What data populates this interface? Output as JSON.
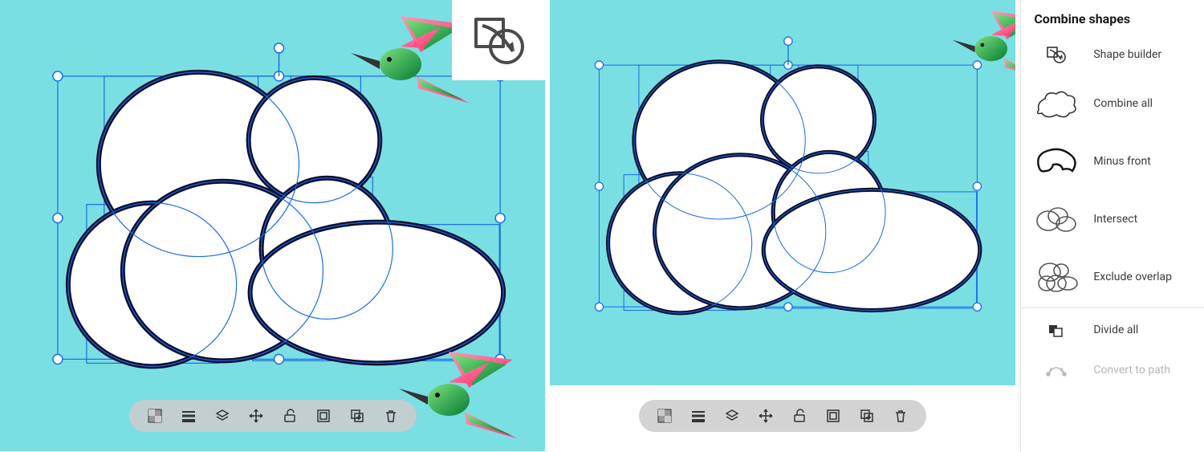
{
  "colors": {
    "canvas_bg": "#79dfe3",
    "selection": "#1a6de6",
    "shape_stroke": "#0b0d2c",
    "shape_fill": "#ffffff",
    "bird_pink": "#ff4b86",
    "bird_green": "#1eab4f"
  },
  "panel": {
    "title": "Combine shapes",
    "items": [
      {
        "id": "shape-builder",
        "label": "Shape builder",
        "disabled": false
      },
      {
        "id": "combine-all",
        "label": "Combine all",
        "disabled": false
      },
      {
        "id": "minus-front",
        "label": "Minus front",
        "disabled": false
      },
      {
        "id": "intersect",
        "label": "Intersect",
        "disabled": false
      },
      {
        "id": "exclude-overlap",
        "label": "Exclude overlap",
        "disabled": false
      },
      {
        "id": "divide-all",
        "label": "Divide all",
        "disabled": false
      },
      {
        "id": "convert-to-path",
        "label": "Convert to path",
        "disabled": true
      }
    ]
  },
  "toolbar": {
    "items": [
      {
        "id": "fill-swatch",
        "tooltip": "Fill"
      },
      {
        "id": "stroke-weight",
        "tooltip": "Stroke"
      },
      {
        "id": "layers",
        "tooltip": "Arrange"
      },
      {
        "id": "move",
        "tooltip": "Move"
      },
      {
        "id": "lock",
        "tooltip": "Lock"
      },
      {
        "id": "group",
        "tooltip": "Group"
      },
      {
        "id": "duplicate",
        "tooltip": "Duplicate"
      },
      {
        "id": "delete",
        "tooltip": "Delete"
      }
    ]
  },
  "callout": {
    "icon": "shape-builder-tool"
  }
}
